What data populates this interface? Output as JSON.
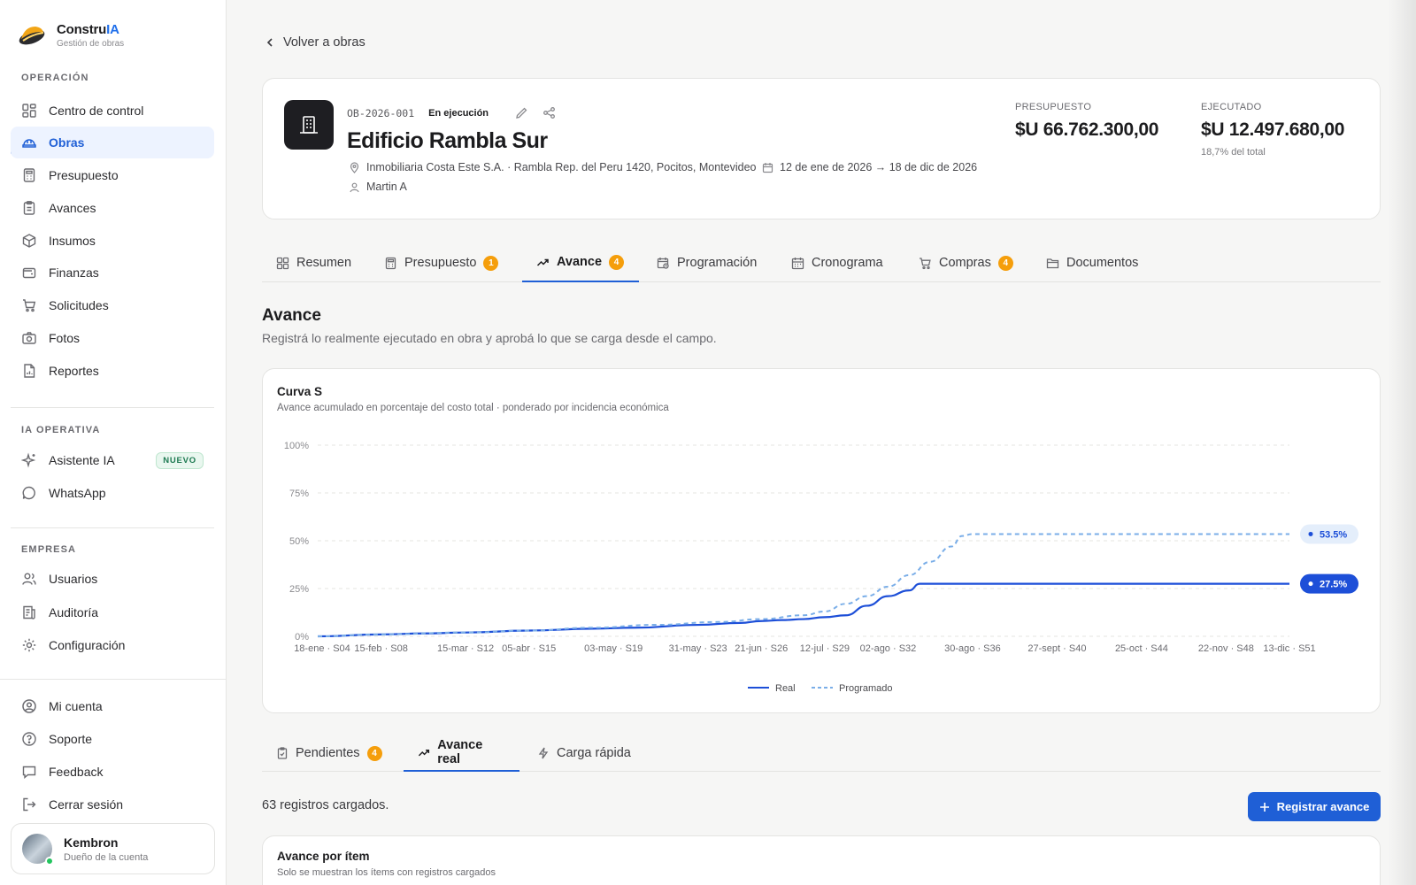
{
  "brand": {
    "name_main": "Constru",
    "name_accent": "IA",
    "subtitle": "Gestión de obras"
  },
  "sidebar": {
    "sections": {
      "operacion": "OPERACIÓN",
      "ia": "IA OPERATIVA",
      "empresa": "EMPRESA"
    },
    "operacion_items": [
      {
        "label": "Centro de control",
        "icon": "dashboard-icon"
      },
      {
        "label": "Obras",
        "icon": "helmet-icon",
        "active": true
      },
      {
        "label": "Presupuesto",
        "icon": "calculator-icon"
      },
      {
        "label": "Avances",
        "icon": "clipboard-icon"
      },
      {
        "label": "Insumos",
        "icon": "box-icon"
      },
      {
        "label": "Finanzas",
        "icon": "wallet-icon"
      },
      {
        "label": "Solicitudes",
        "icon": "cart-icon"
      },
      {
        "label": "Fotos",
        "icon": "camera-icon"
      },
      {
        "label": "Reportes",
        "icon": "report-icon"
      }
    ],
    "ia_items": [
      {
        "label": "Asistente IA",
        "icon": "sparkle-icon",
        "badge": "NUEVO"
      },
      {
        "label": "WhatsApp",
        "icon": "chat-bubble-icon"
      }
    ],
    "empresa_items": [
      {
        "label": "Usuarios",
        "icon": "users-icon"
      },
      {
        "label": "Auditoría",
        "icon": "audit-icon"
      },
      {
        "label": "Configuración",
        "icon": "gear-icon"
      }
    ],
    "footer_items": [
      {
        "label": "Mi cuenta",
        "icon": "user-circle-icon"
      },
      {
        "label": "Soporte",
        "icon": "help-icon"
      },
      {
        "label": "Feedback",
        "icon": "message-icon"
      },
      {
        "label": "Cerrar sesión",
        "icon": "logout-icon"
      }
    ],
    "user": {
      "name": "Kembron",
      "role": "Dueño de la cuenta"
    }
  },
  "back_link": "Volver a obras",
  "project": {
    "code": "OB-2026-001",
    "status": "En ejecución",
    "title": "Edificio Rambla Sur",
    "client_address": "Inmobiliaria Costa Este S.A. · Rambla Rep. del Peru 1420, Pocitos, Montevideo",
    "dates": "12 de ene de 2026 → 18 de dic de 2026",
    "manager": "Martin A",
    "budget_label": "PRESUPUESTO",
    "budget_value": "$U 66.762.300,00",
    "executed_label": "EJECUTADO",
    "executed_value": "$U 12.497.680,00",
    "executed_sub": "18,7% del total"
  },
  "tabs": [
    {
      "label": "Resumen",
      "icon": "grid-icon"
    },
    {
      "label": "Presupuesto",
      "icon": "calculator-icon",
      "count": "1"
    },
    {
      "label": "Avance",
      "icon": "trend-icon",
      "count": "4",
      "active": true
    },
    {
      "label": "Programación",
      "icon": "calendar-clock-icon"
    },
    {
      "label": "Cronograma",
      "icon": "calendar-icon"
    },
    {
      "label": "Compras",
      "icon": "cart-icon",
      "count": "4"
    },
    {
      "label": "Documentos",
      "icon": "folder-icon"
    }
  ],
  "section": {
    "title": "Avance",
    "subtitle": "Registrá lo realmente ejecutado en obra y aprobá lo que se carga desde el campo."
  },
  "chart_card": {
    "title": "Curva S",
    "subtitle": "Avance acumulado en porcentaje del costo total · ponderado por incidencia económica"
  },
  "chart_data": {
    "type": "line",
    "title": "Curva S",
    "xlabel": "",
    "ylabel": "",
    "y_ticks": [
      "0%",
      "25%",
      "50%",
      "75%",
      "100%"
    ],
    "ylim": [
      0,
      100
    ],
    "x_ticks": [
      "18-ene · S04",
      "15-feb · S08",
      "15-mar · S12",
      "05-abr · S15",
      "03-may · S19",
      "31-may · S23",
      "21-jun · S26",
      "12-jul · S29",
      "02-ago · S32",
      "30-ago · S36",
      "27-sept · S40",
      "25-oct · S44",
      "22-nov · S48",
      "13-dic · S51"
    ],
    "x_tick_weeks": [
      4,
      8,
      12,
      15,
      19,
      23,
      26,
      29,
      32,
      36,
      40,
      44,
      48,
      51
    ],
    "xlim_weeks": [
      5,
      51
    ],
    "grid": true,
    "legend_position": "bottom-center",
    "series": [
      {
        "name": "Real",
        "color": "#1d4fd8",
        "style": "solid",
        "weeks": [
          5,
          8,
          10,
          12,
          15,
          18,
          20,
          23,
          25,
          26,
          27,
          28,
          29,
          30,
          31,
          32,
          33,
          33.5,
          35,
          40,
          45,
          51
        ],
        "values": [
          0,
          1,
          1.5,
          2,
          3,
          4,
          4.5,
          6,
          7,
          8,
          8.5,
          9,
          10,
          11,
          16,
          21,
          24,
          27.5,
          27.5,
          27.5,
          27.5,
          27.5
        ],
        "end_label": "27.5%"
      },
      {
        "name": "Programado",
        "color": "#7aaee8",
        "style": "dashed",
        "weeks": [
          5,
          8,
          12,
          15,
          18,
          21,
          24,
          26,
          28,
          29,
          30,
          31,
          32,
          33,
          34,
          35,
          35.5,
          36,
          40,
          45,
          51
        ],
        "values": [
          0,
          1,
          2,
          3,
          4.5,
          6,
          7.5,
          9,
          11,
          13,
          17,
          21,
          26,
          32,
          39,
          47,
          52.5,
          53.5,
          53.5,
          53.5,
          53.5
        ],
        "end_label": "53.5%"
      }
    ]
  },
  "subtabs": [
    {
      "label": "Pendientes",
      "icon": "clipboard-check-icon",
      "count": "4"
    },
    {
      "label": "Avance real",
      "icon": "trend-icon",
      "active": true
    },
    {
      "label": "Carga rápida",
      "icon": "bolt-icon"
    }
  ],
  "records_text": "63 registros cargados.",
  "register_button": "Registrar avance",
  "items_card": {
    "title": "Avance por ítem",
    "subtitle": "Solo se muestran los ítems con registros cargados"
  }
}
